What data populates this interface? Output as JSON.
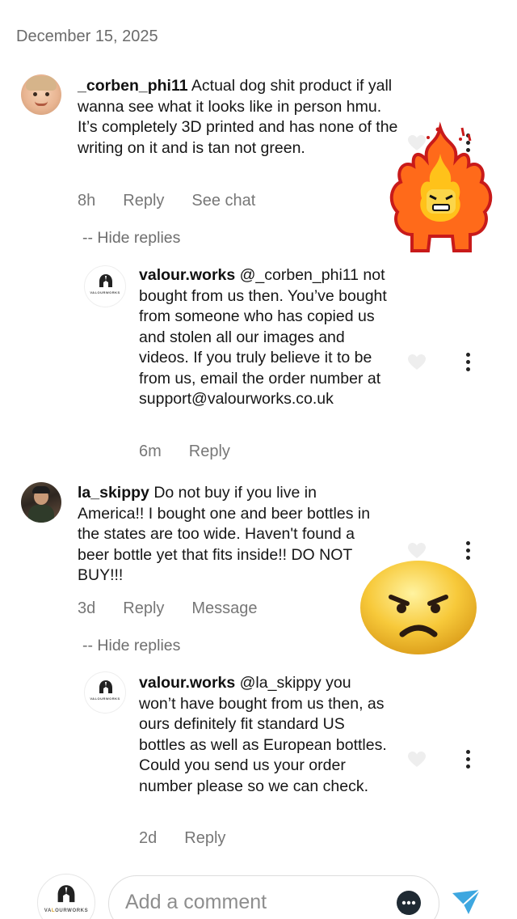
{
  "header": {
    "date": "December 15, 2025"
  },
  "comments": [
    {
      "username": "_corben_phi11",
      "text": "Actual dog shit product if yall wanna see what it looks like in person hmu. It’s completely 3D printed and has none of the writing on it and is tan not green.",
      "time": "8h",
      "reply_label": "Reply",
      "extra_action": "See chat",
      "hide_replies": "-- Hide replies",
      "reply": {
        "username": "valour.works",
        "text": "@_corben_phi11 not bought from us then. You’ve bought from someone who has copied us and stolen all our images and videos. If you truly believe it to be from us, email the order number at support@valourworks.co.uk",
        "time": "6m",
        "reply_label": "Reply",
        "brand_watermark": "VALOURWORKS"
      }
    },
    {
      "username": "la_skippy",
      "text": "Do not buy if you live in America!! I bought one and beer bottles in the states are too wide. Haven't found a beer bottle yet that fits inside!! DO NOT BUY!!!",
      "time": "3d",
      "reply_label": "Reply",
      "extra_action": "Message",
      "hide_replies": "-- Hide replies",
      "reply": {
        "username": "valour.works",
        "text": "@la_skippy you won’t have bought from us then, as ours definitely fit standard US bottles as well as European bottles. Could you send us your order number please so we can check.",
        "time": "2d",
        "reply_label": "Reply",
        "brand_watermark": "VALOURWORKS"
      }
    }
  ],
  "composer": {
    "placeholder": "Add a comment",
    "watermark_prefix": "VA",
    "watermark_highlight": "L",
    "watermark_suffix": "OURWORKS"
  },
  "icons": {
    "like": "heart-outline-icon",
    "more": "more-vertical-icon",
    "chat": "chat-bubble-icon",
    "send": "send-arrow-icon"
  },
  "colors": {
    "send": "#3ea7e0",
    "secondary_text": "#777777",
    "like_icon": "#e8e8e8"
  }
}
